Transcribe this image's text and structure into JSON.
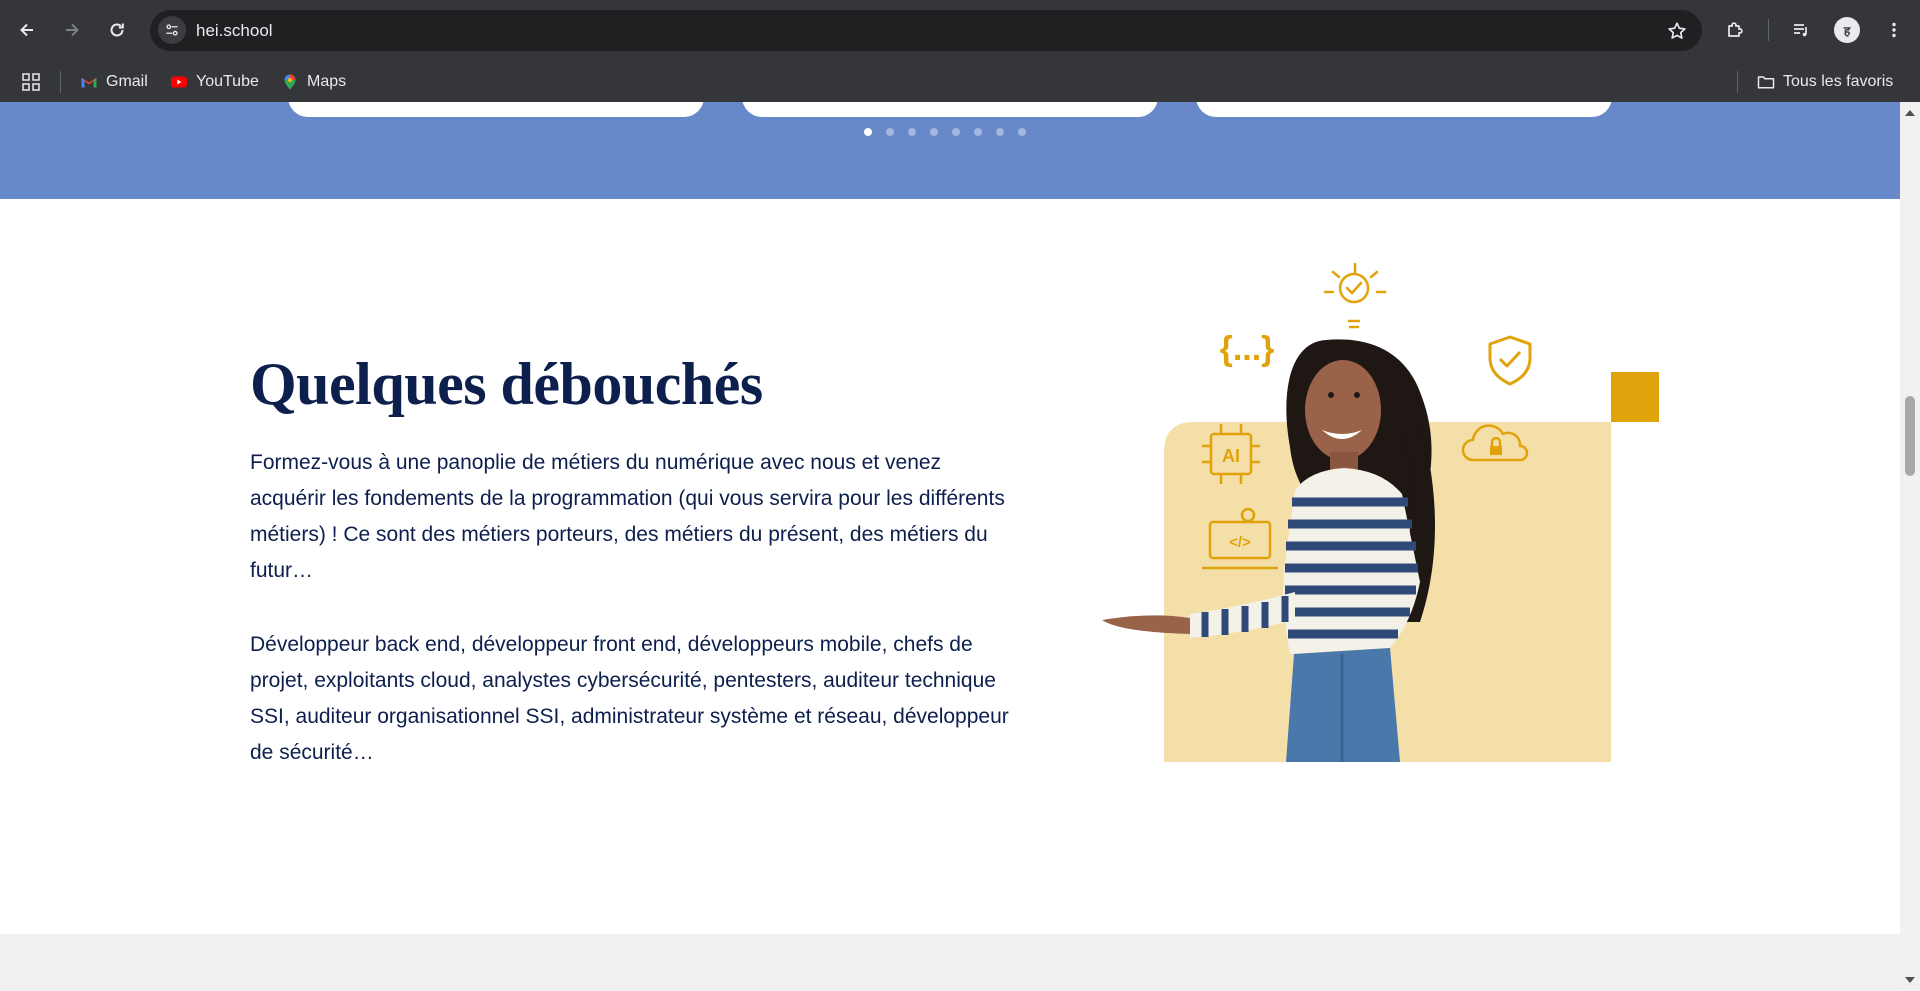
{
  "browser": {
    "url": "hei.school",
    "profile_initial": "ह",
    "bookmarks": [
      {
        "label": "Gmail",
        "icon": "gmail-icon"
      },
      {
        "label": "YouTube",
        "icon": "youtube-icon"
      },
      {
        "label": "Maps",
        "icon": "maps-icon"
      }
    ],
    "all_bookmarks_label": "Tous les favoris"
  },
  "carousel": {
    "dot_count": 8,
    "active_index": 0
  },
  "section": {
    "title": "Quelques débouchés",
    "paragraph1": "Formez-vous à une panoplie de métiers du numérique avec nous et venez acquérir les fondements de la programmation (qui vous servira pour les différents métiers) ! Ce sont des métiers porteurs, des métiers du présent, des métiers du futur…",
    "paragraph2": "Développeur back end, développeur front end, développeurs mobile, chefs de projet, exploitants cloud, analystes cybersécurité, pentesters, auditeur technique SSI, auditeur organisationnel SSI, administrateur système et réseau, développeur de sécurité…",
    "illustration_icons": [
      "braces-icon",
      "lightbulb-icon",
      "shield-check-icon",
      "ai-chip-icon",
      "cloud-lock-icon",
      "laptop-code-icon"
    ]
  },
  "colors": {
    "chrome_bg": "#35363a",
    "blue_band": "#6889c9",
    "heading": "#0d1f4d",
    "accent_gold": "#e0a30b",
    "pale_yellow": "#f4dfa8"
  }
}
